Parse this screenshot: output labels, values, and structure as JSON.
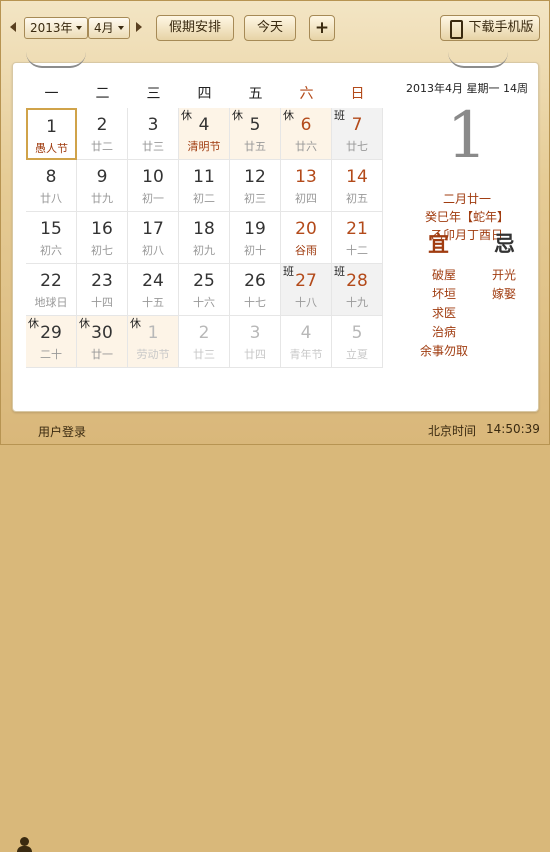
{
  "toolbar": {
    "year": "2013年",
    "month": "4月",
    "holiday_btn": "假期安排",
    "today_btn": "今天",
    "add_btn": "+",
    "download_btn": "下载手机版"
  },
  "weekdays": [
    "一",
    "二",
    "三",
    "四",
    "五",
    "六",
    "日"
  ],
  "days": [
    {
      "n": "1",
      "s": "愚人节",
      "fest": true,
      "today": true
    },
    {
      "n": "2",
      "s": "廿二"
    },
    {
      "n": "3",
      "s": "廿三"
    },
    {
      "n": "4",
      "s": "清明节",
      "fest": true,
      "tag": "休",
      "hol": true
    },
    {
      "n": "5",
      "s": "廿五",
      "tag": "休",
      "hol": true
    },
    {
      "n": "6",
      "s": "廿六",
      "tag": "休",
      "hol": true,
      "we": true
    },
    {
      "n": "7",
      "s": "廿七",
      "tag": "班",
      "work": true,
      "we": true
    },
    {
      "n": "8",
      "s": "廿八"
    },
    {
      "n": "9",
      "s": "廿九"
    },
    {
      "n": "10",
      "s": "初一"
    },
    {
      "n": "11",
      "s": "初二"
    },
    {
      "n": "12",
      "s": "初三"
    },
    {
      "n": "13",
      "s": "初四",
      "we": true
    },
    {
      "n": "14",
      "s": "初五",
      "we": true
    },
    {
      "n": "15",
      "s": "初六"
    },
    {
      "n": "16",
      "s": "初七"
    },
    {
      "n": "17",
      "s": "初八"
    },
    {
      "n": "18",
      "s": "初九"
    },
    {
      "n": "19",
      "s": "初十"
    },
    {
      "n": "20",
      "s": "谷雨",
      "fest": true,
      "we": true
    },
    {
      "n": "21",
      "s": "十二",
      "we": true
    },
    {
      "n": "22",
      "s": "地球日"
    },
    {
      "n": "23",
      "s": "十四"
    },
    {
      "n": "24",
      "s": "十五"
    },
    {
      "n": "25",
      "s": "十六"
    },
    {
      "n": "26",
      "s": "十七"
    },
    {
      "n": "27",
      "s": "十八",
      "tag": "班",
      "work": true,
      "we": true
    },
    {
      "n": "28",
      "s": "十九",
      "tag": "班",
      "work": true,
      "we": true
    },
    {
      "n": "29",
      "s": "二十",
      "tag": "休",
      "hol": true
    },
    {
      "n": "30",
      "s": "廿一",
      "tag": "休",
      "hol": true
    },
    {
      "n": "1",
      "s": "劳动节",
      "tag": "休",
      "hol": true,
      "other": true
    },
    {
      "n": "2",
      "s": "廿三",
      "other": true
    },
    {
      "n": "3",
      "s": "廿四",
      "other": true
    },
    {
      "n": "4",
      "s": "青年节",
      "other": true
    },
    {
      "n": "5",
      "s": "立夏",
      "fest": true,
      "other": true
    }
  ],
  "side": {
    "date_line": "2013年4月 星期一 14周",
    "big_day": "1",
    "lunar1": "二月廿一",
    "lunar2": "癸巳年【蛇年】",
    "lunar3": "乙卯月丁酉日",
    "yi": "宜",
    "ji": "忌",
    "yi_items": [
      "破屋",
      "坏垣",
      "求医",
      "治病",
      "余事勿取"
    ],
    "ji_items": [
      "开光",
      "嫁娶"
    ]
  },
  "footer": {
    "login": "用户登录",
    "time_label": "北京时间",
    "time": "14:50:39"
  },
  "colors": {
    "accent": "#b34a1a",
    "frame": "#d9b77a",
    "today_border": "#d0a34a"
  }
}
